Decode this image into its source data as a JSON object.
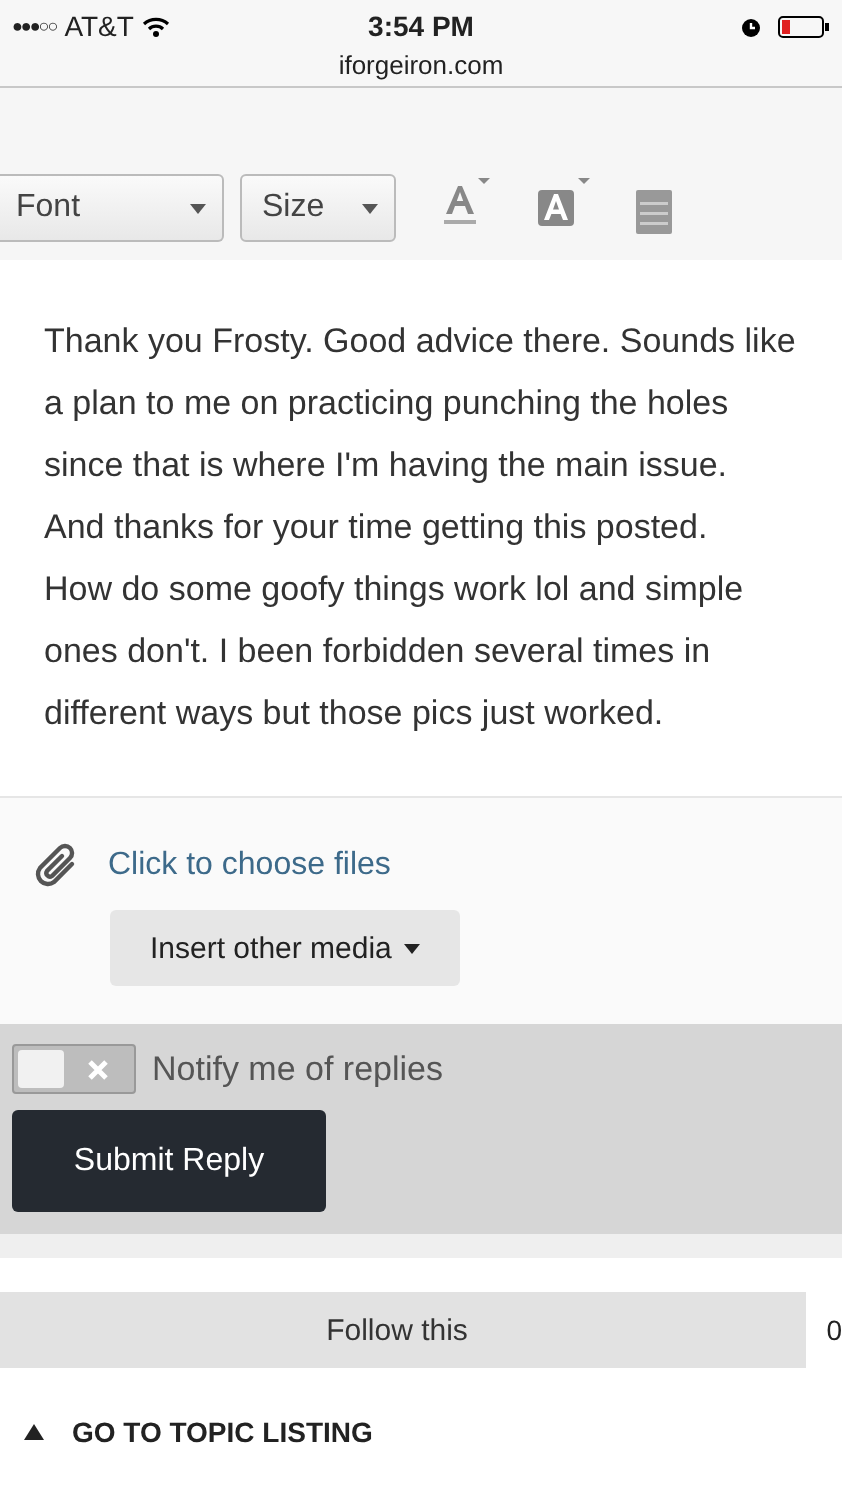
{
  "status_bar": {
    "signal_dots": "●●●○○",
    "carrier": "AT&T",
    "time": "3:54 PM",
    "url": "iforgeiron.com"
  },
  "toolbar": {
    "font": "Font",
    "size": "Size"
  },
  "editor": {
    "text": "Thank you Frosty. Good advice there. Sounds like a plan to me on practicing punching the holes since that is where I'm having the main issue.  And thanks for your time getting this posted.    How do some goofy things work lol and simple ones don't. I been forbidden several times in different ways but those pics just worked."
  },
  "attachments": {
    "link": "Click to choose files",
    "media_button": "Insert other media"
  },
  "notify": {
    "label": "Notify me of replies",
    "on": false
  },
  "submit": "Submit Reply",
  "follow": {
    "label": "Follow this",
    "count": "0"
  },
  "topic_link": "GO TO TOPIC LISTING"
}
